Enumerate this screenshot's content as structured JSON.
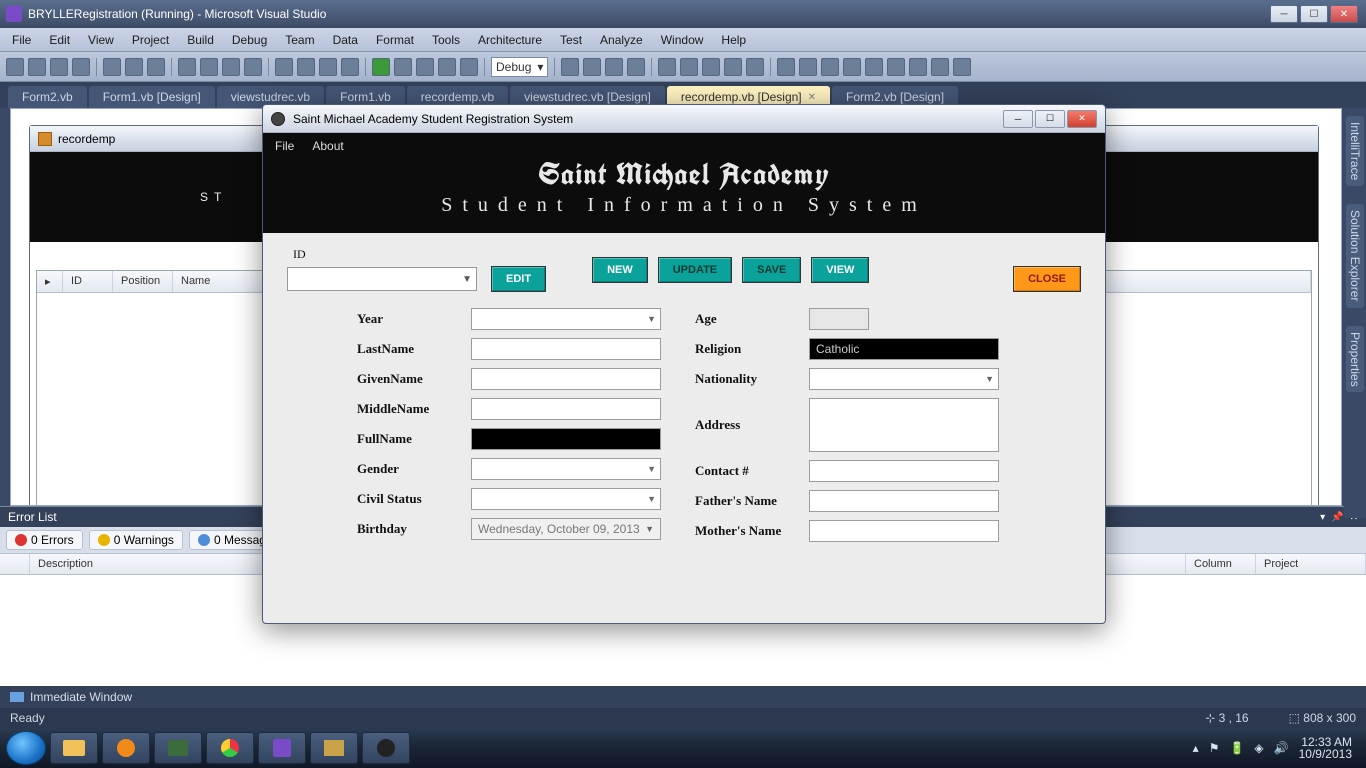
{
  "window_title": "BRYLLERegistration (Running) - Microsoft Visual Studio",
  "menu": [
    "File",
    "Edit",
    "View",
    "Project",
    "Build",
    "Debug",
    "Team",
    "Data",
    "Format",
    "Tools",
    "Architecture",
    "Test",
    "Analyze",
    "Window",
    "Help"
  ],
  "toolbar_config": "Debug",
  "tabs": [
    {
      "label": "Form2.vb"
    },
    {
      "label": "Form1.vb [Design]"
    },
    {
      "label": "viewstudrec.vb"
    },
    {
      "label": "Form1.vb"
    },
    {
      "label": "recordemp.vb"
    },
    {
      "label": "viewstudrec.vb [Design]"
    },
    {
      "label": "recordemp.vb [Design]",
      "active": true
    },
    {
      "label": "Form2.vb [Design]"
    }
  ],
  "designer_child": {
    "title": "recordemp",
    "banner_text": "ST",
    "grid_cols": [
      "",
      "ID",
      "Position",
      "Name"
    ]
  },
  "right_tabs": [
    "IntelliTrace",
    "Solution Explorer",
    "Properties"
  ],
  "error_list": {
    "title": "Error List",
    "errors_label": "0 Errors",
    "warnings_label": "0 Warnings",
    "messages_label": "0 Messages",
    "columns": [
      "",
      "Description",
      "",
      "",
      "Column",
      "Project"
    ]
  },
  "immediate_label": "Immediate Window",
  "status": {
    "left": "Ready",
    "pos": "3 , 16",
    "size": "808 x 300"
  },
  "tray_time": "12:33 AM",
  "tray_date": "10/9/2013",
  "app": {
    "title": "Saint Michael Academy Student Registration System",
    "menu": [
      "File",
      "About"
    ],
    "h1": "Saint Michael Academy",
    "h2": "Student Information System",
    "id_label": "ID",
    "buttons": {
      "edit": "EDIT",
      "new": "NEW",
      "update": "UPDATE",
      "save": "SAVE",
      "view": "VIEW",
      "close": "CLOSE"
    },
    "fields": {
      "year": "Year",
      "lastname": "LastName",
      "givenname": "GivenName",
      "middlename": "MiddleName",
      "fullname": "FullName",
      "gender": "Gender",
      "civilstatus": "Civil Status",
      "birthday": "Birthday",
      "age": "Age",
      "religion": "Religion",
      "nationality": "Nationality",
      "address": "Address",
      "contact": "Contact #",
      "father": "Father's Name",
      "mother": "Mother's Name"
    },
    "religion_value": "Catholic",
    "birthday_value": "Wednesday,   October   09, 2013"
  }
}
